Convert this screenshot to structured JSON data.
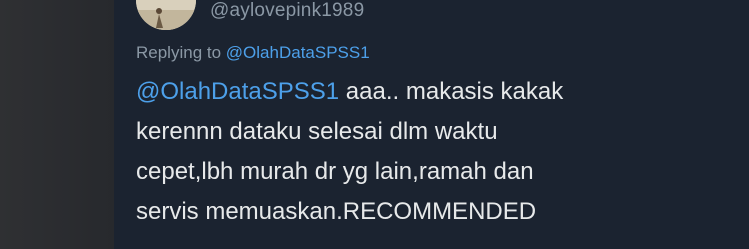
{
  "tweet": {
    "handle": "@aylovepink1989",
    "replying_label": "Replying to",
    "replying_to": "@OlahDataSPSS1",
    "text_mention": "@OlahDataSPSS1",
    "lines": [
      " aaa.. makasis kakak",
      "kerennn dataku selesai dlm waktu",
      "cepet,lbh murah dr yg lain,ramah dan",
      "servis memuaskan.RECOMMENDED"
    ]
  },
  "colors": {
    "card_bg": "#1b2330",
    "mention": "#4da0ea",
    "text": "#e7e9ea",
    "muted": "#8b98a5"
  }
}
